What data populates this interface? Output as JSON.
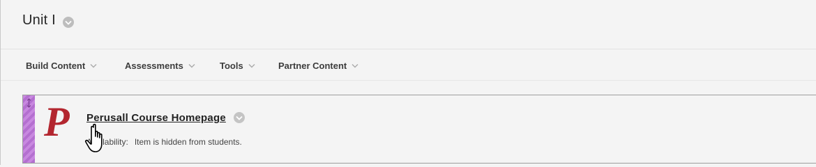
{
  "header": {
    "title": "Unit I",
    "title_menu_icon": "chevron-down-circle-icon"
  },
  "toolbar": {
    "items": [
      {
        "label": "Build Content"
      },
      {
        "label": "Assessments"
      },
      {
        "label": "Tools"
      },
      {
        "label": "Partner Content"
      }
    ]
  },
  "content_item": {
    "icon_letter": "P",
    "title": "Perusall Course Homepage",
    "availability_label": "Availability:",
    "availability_value": "Item is hidden from students.",
    "colors": {
      "accent_stripe": "#c888e0",
      "icon_red": "#b3262f"
    }
  },
  "cursor": {
    "type": "hand-pointer-icon"
  }
}
